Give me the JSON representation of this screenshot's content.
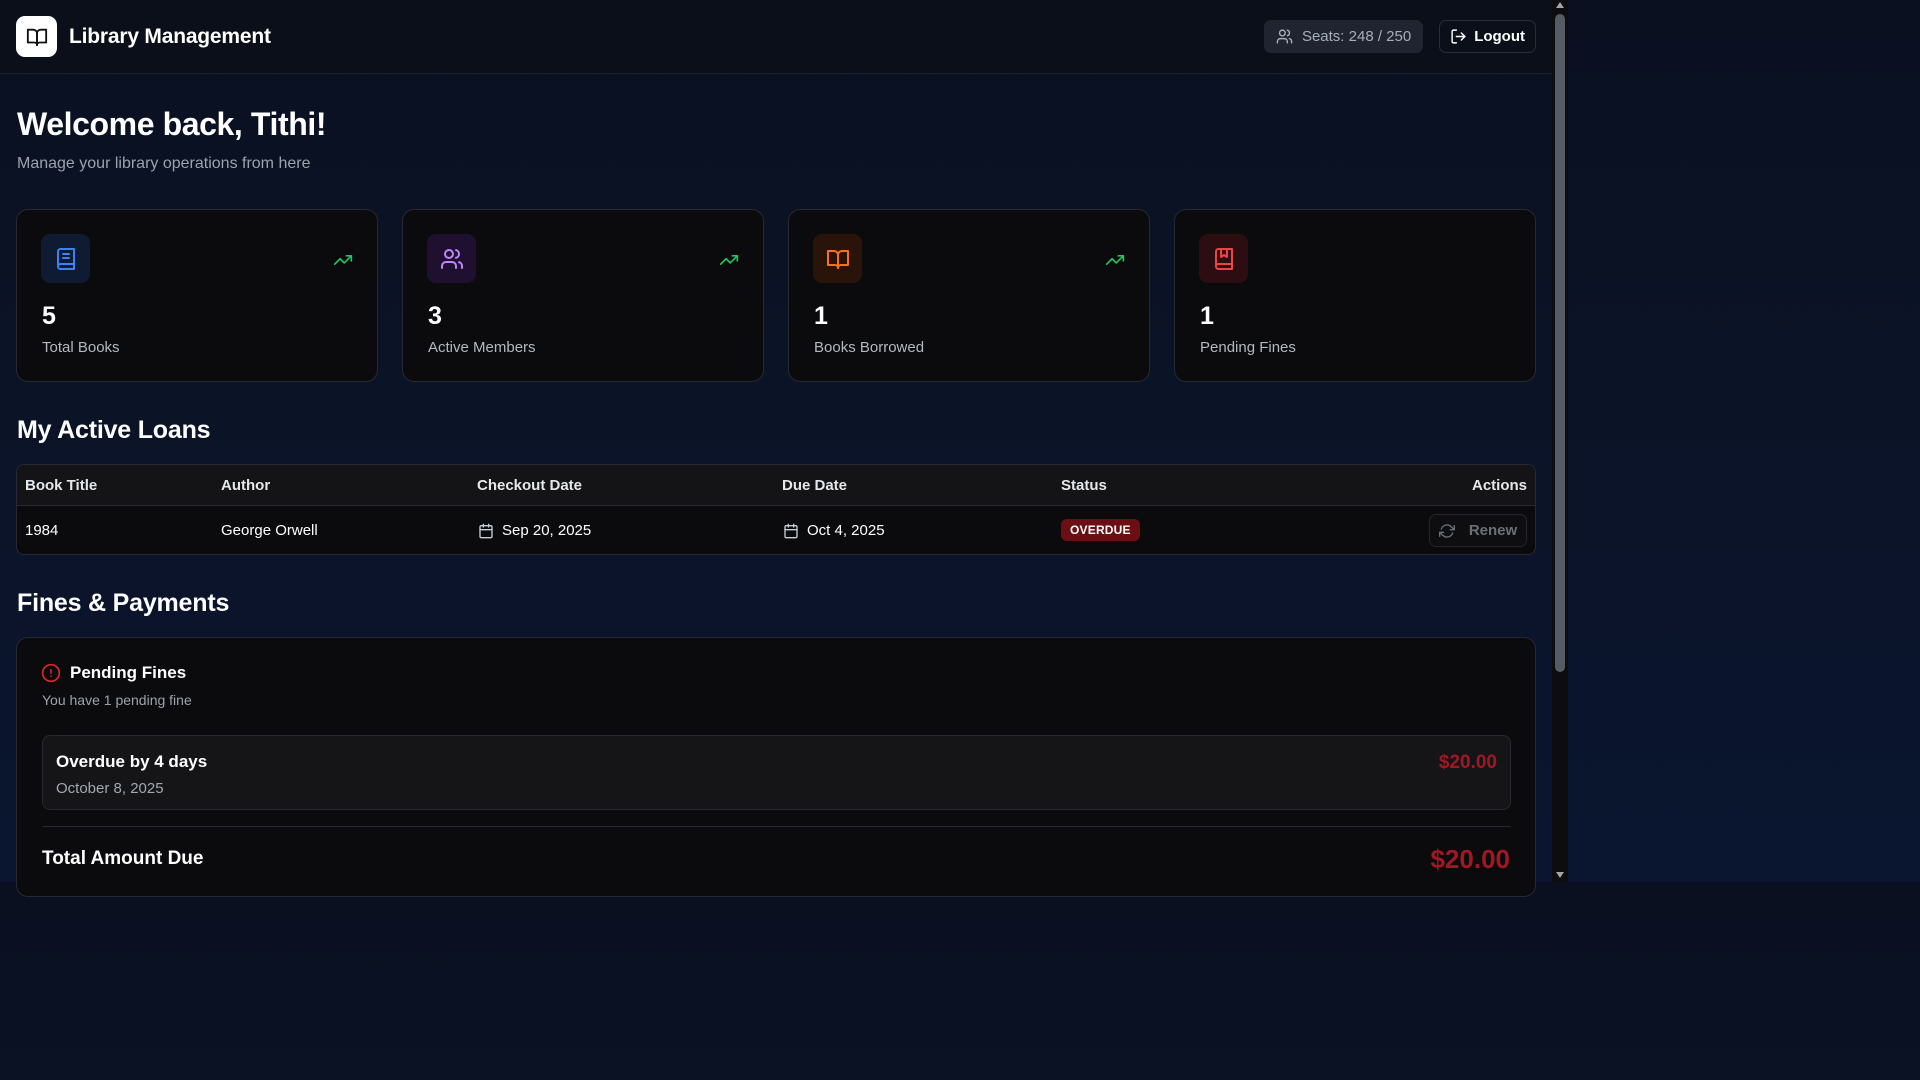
{
  "header": {
    "app_title": "Library Management",
    "seats_label": "Seats: 248 / 250",
    "logout_label": "Logout"
  },
  "welcome": {
    "title": "Welcome back, Tithi!",
    "subtitle": "Manage your library operations from here"
  },
  "stats": [
    {
      "value": "5",
      "label": "Total Books",
      "icon": "book-icon",
      "color": "#3b82f6",
      "bg": "#0f1a33",
      "trend": true
    },
    {
      "value": "3",
      "label": "Active Members",
      "icon": "users-icon",
      "color": "#c084fc",
      "bg": "#1f1030",
      "trend": true
    },
    {
      "value": "1",
      "label": "Books Borrowed",
      "icon": "open-book-icon",
      "color": "#f97316",
      "bg": "#2a1409",
      "trend": true
    },
    {
      "value": "1",
      "label": "Pending Fines",
      "icon": "bookmark-book-icon",
      "color": "#ef4444",
      "bg": "#2b0d12",
      "trend": false
    }
  ],
  "loans": {
    "section_title": "My Active Loans",
    "columns": [
      "Book Title",
      "Author",
      "Checkout Date",
      "Due Date",
      "Status",
      "Actions"
    ],
    "rows": [
      {
        "title": "1984",
        "author": "George Orwell",
        "checkout": "Sep 20, 2025",
        "due": "Oct 4, 2025",
        "status": "OVERDUE",
        "action": "Renew"
      }
    ]
  },
  "fines": {
    "section_title": "Fines & Payments",
    "card_title": "Pending Fines",
    "card_subtitle": "You have 1 pending fine",
    "items": [
      {
        "title": "Overdue by 4 days",
        "date": "October 8, 2025",
        "amount": "$20.00"
      }
    ],
    "total_label": "Total Amount Due",
    "total_amount": "$20.00"
  },
  "colors": {
    "trend_green": "#22c55e",
    "danger_red": "#a01823",
    "overdue_badge": "#6b0f14"
  }
}
